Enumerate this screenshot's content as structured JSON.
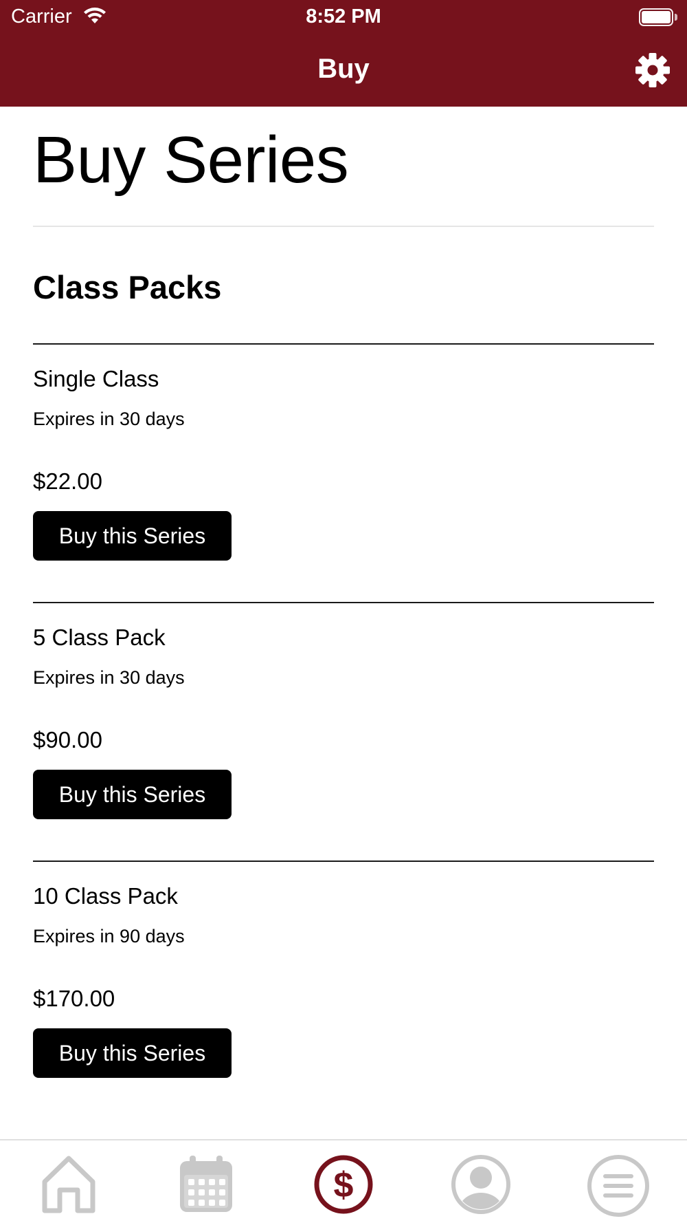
{
  "status_bar": {
    "carrier": "Carrier",
    "time": "8:52 PM"
  },
  "nav": {
    "title": "Buy",
    "settings_icon": "gear-icon"
  },
  "page": {
    "title": "Buy Series",
    "section_title": "Class Packs"
  },
  "packs": [
    {
      "name": "Single Class",
      "expires": "Expires in 30 days",
      "price": "$22.00",
      "button": "Buy this Series"
    },
    {
      "name": "5 Class Pack",
      "expires": "Expires in 30 days",
      "price": "$90.00",
      "button": "Buy this Series"
    },
    {
      "name": "10 Class Pack",
      "expires": "Expires in 90 days",
      "price": "$170.00",
      "button": "Buy this Series"
    }
  ],
  "tabbar": {
    "items": [
      {
        "icon": "home-icon",
        "active": false
      },
      {
        "icon": "calendar-icon",
        "active": false
      },
      {
        "icon": "dollar-icon",
        "active": true
      },
      {
        "icon": "profile-icon",
        "active": false
      },
      {
        "icon": "menu-icon",
        "active": false
      }
    ]
  },
  "colors": {
    "brand": "#76121c",
    "tab_inactive": "#c8c8c8",
    "button": "#000000"
  }
}
